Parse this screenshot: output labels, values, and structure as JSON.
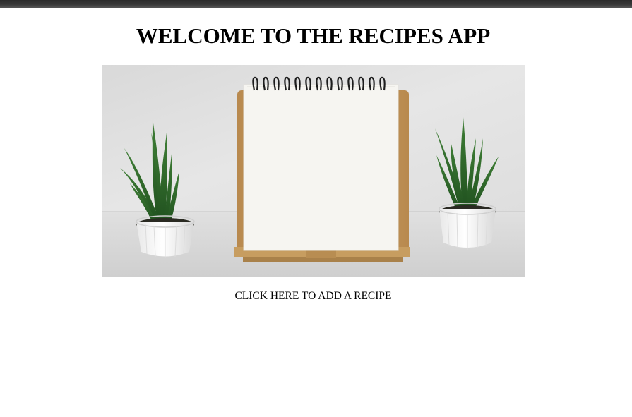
{
  "header": {
    "title": "WELCOME TO THE RECIPES APP"
  },
  "hero_image": {
    "alt": "Blank spiral notebook on a wooden stand between two potted snake plants"
  },
  "actions": {
    "add_recipe_label": "CLICK HERE TO ADD A RECIPE"
  },
  "colors": {
    "page_background": "#ffffff",
    "text": "#000000",
    "browser_bar": "#333333",
    "wall": "#e3e3e3",
    "table": "#d6d6d6",
    "plant_green": "#2f6b2b",
    "pot_white": "#f4f4f4",
    "wood": "#c9a46a",
    "paper": "#f7f6f2",
    "spiral": "#222222"
  }
}
